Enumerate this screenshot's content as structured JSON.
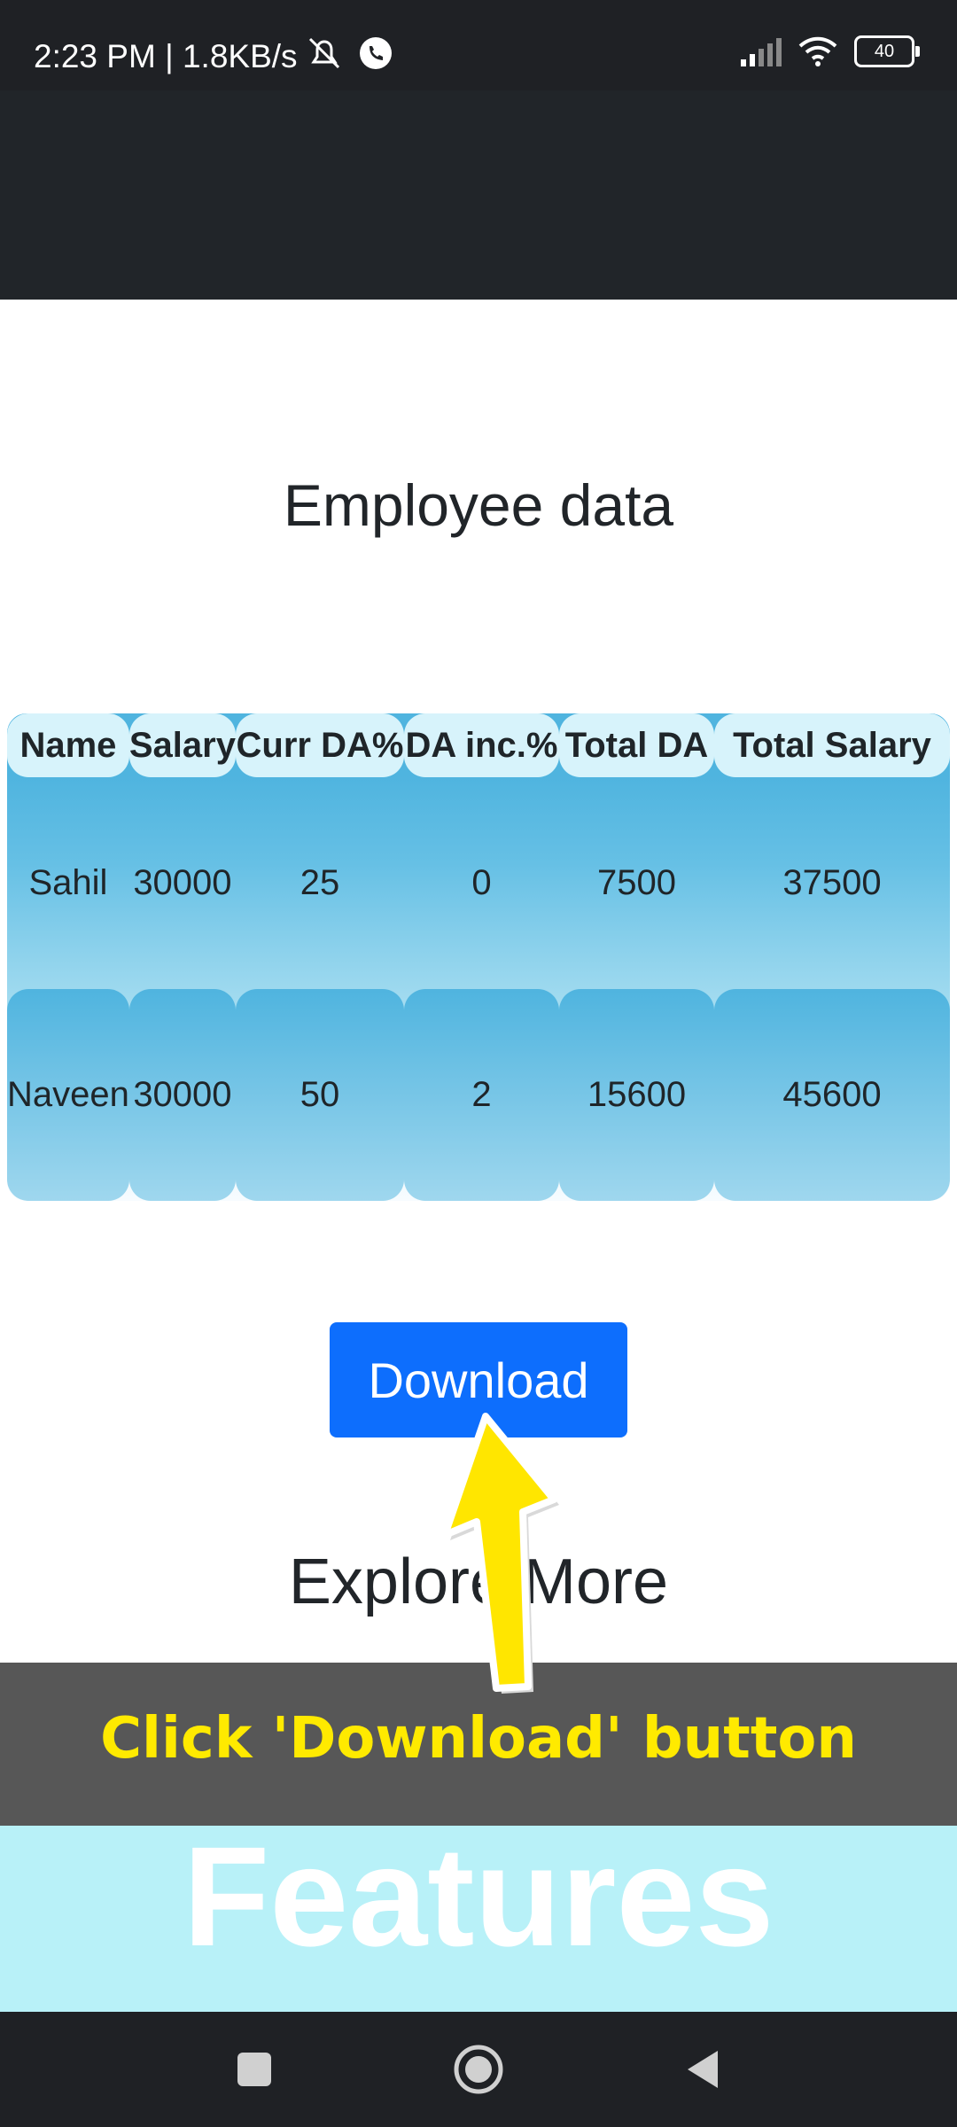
{
  "status_bar": {
    "time_speed": "2:23 PM | 1.8KB/s",
    "battery": "40",
    "icons": [
      "mute-icon",
      "phone-icon",
      "signal-icon",
      "wifi-icon",
      "battery-icon"
    ]
  },
  "page": {
    "title": "Employee data",
    "table": {
      "headers": [
        "Name",
        "Salary",
        "Curr DA%",
        "DA inc.%",
        "Total DA",
        "Total Salary"
      ],
      "rows": [
        [
          "Sahil",
          "30000",
          "25",
          "0",
          "7500",
          "37500"
        ],
        [
          "Naveen",
          "30000",
          "50",
          "2",
          "15600",
          "45600"
        ]
      ]
    },
    "download_label": "Download",
    "explore_title": "Explore More",
    "features_title": "Features"
  },
  "overlay": {
    "instruction": "Click 'Download' button",
    "arrow_color": "#ffe600"
  },
  "colors": {
    "primary_button": "#0d6efd",
    "header": "#212529",
    "table_top": "#4fb4df",
    "features_bg": "#b8f1f8"
  }
}
